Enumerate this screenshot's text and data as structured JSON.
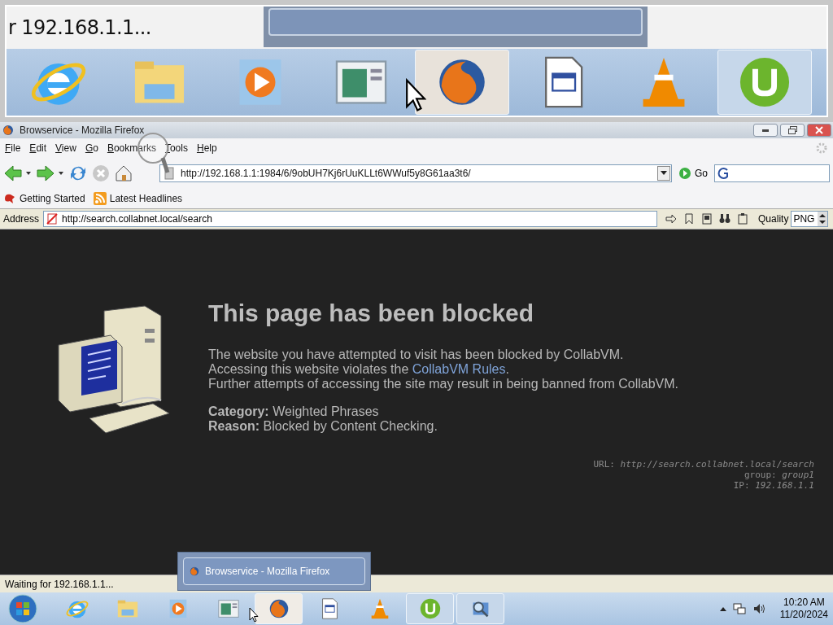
{
  "magnifier": {
    "status_text": "r 192.168.1.1...",
    "taskbar_items": [
      {
        "kind": "ie",
        "running": false,
        "selected": false
      },
      {
        "kind": "folder",
        "running": false,
        "selected": false
      },
      {
        "kind": "media",
        "running": false,
        "selected": false
      },
      {
        "kind": "app",
        "running": false,
        "selected": false
      },
      {
        "kind": "firefox",
        "running": true,
        "selected": true
      },
      {
        "kind": "document",
        "running": false,
        "selected": false
      },
      {
        "kind": "vlc",
        "running": false,
        "selected": false
      },
      {
        "kind": "utorrent",
        "running": true,
        "selected": false
      }
    ]
  },
  "window": {
    "title": "Browservice - Mozilla Firefox"
  },
  "menu": [
    "File",
    "Edit",
    "View",
    "Go",
    "Bookmarks",
    "Tools",
    "Help"
  ],
  "navigation": {
    "url": "http://192.168.1.1:1984/6/9obUH7Kj6rUuKLLt6WWuf5y8G61aa3t6/",
    "go_label": "Go"
  },
  "bookmarks": [
    "Getting Started",
    "Latest Headlines"
  ],
  "address_bar": {
    "label": "Address",
    "url": "http://search.collabnet.local/search",
    "quality_label": "Quality",
    "quality_value": "PNG"
  },
  "page": {
    "heading": "This page has been blocked",
    "lines": [
      "The website you have attempted to visit has been blocked by CollabVM.",
      "Accessing this website violates the ",
      "Further attempts of accessing the site may result in being banned from CollabVM."
    ],
    "link": "CollabVM Rules",
    "link_after": ".",
    "details": [
      "**Category:** Weighted Phrases",
      "**Reason:** Blocked by Content Checking."
    ],
    "meta": [
      "URL: *http://search.collabnet.local/search*",
      "group: *group1*",
      "IP: *192.168.1.1*"
    ]
  },
  "status_bar": "Waiting for 192.168.1.1...",
  "tooltip": "Browservice - Mozilla Firefox",
  "taskbar": {
    "items": [
      {
        "kind": "ie",
        "running": false,
        "selected": false
      },
      {
        "kind": "folder",
        "running": false,
        "selected": false
      },
      {
        "kind": "media",
        "running": false,
        "selected": false
      },
      {
        "kind": "app",
        "running": false,
        "selected": false
      },
      {
        "kind": "firefox",
        "running": true,
        "selected": true
      },
      {
        "kind": "document",
        "running": false,
        "selected": false
      },
      {
        "kind": "vlc",
        "running": false,
        "selected": false
      },
      {
        "kind": "utorrent",
        "running": true,
        "selected": false
      },
      {
        "kind": "search-app",
        "running": true,
        "selected": false
      }
    ],
    "time": "10:20 AM",
    "date": "11/20/2024"
  }
}
